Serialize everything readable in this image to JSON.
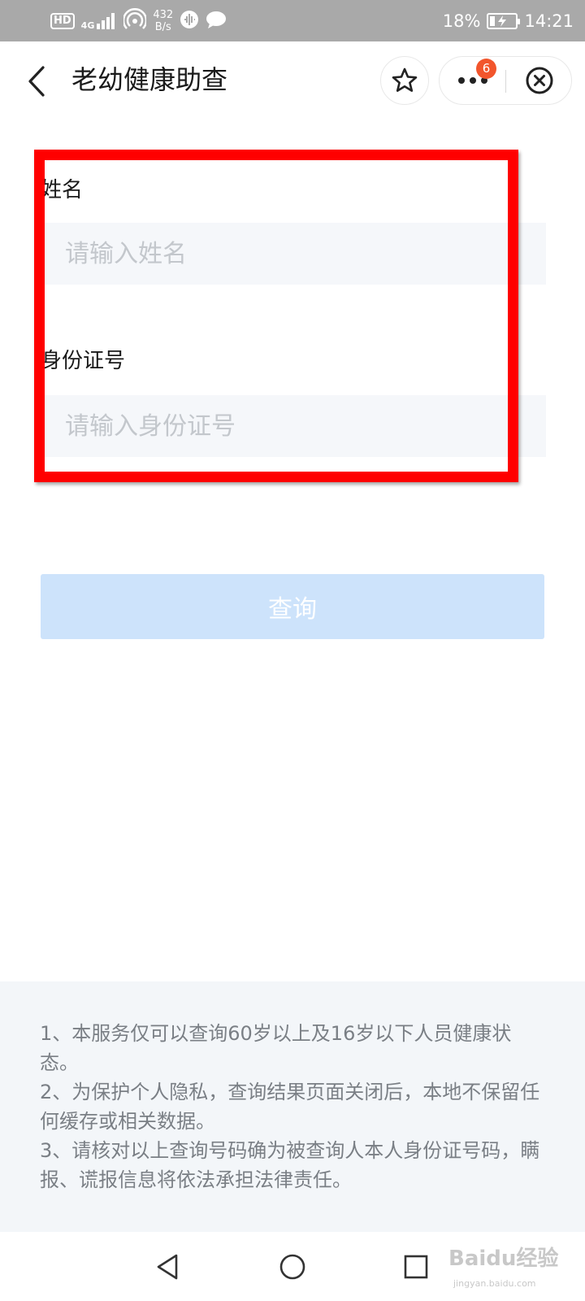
{
  "status_bar": {
    "hd": "HD",
    "network": "4G",
    "speed_value": "432",
    "speed_unit": "B/s",
    "battery_percent": "18%",
    "battery_level": 0.18,
    "time": "14:21"
  },
  "header": {
    "title": "老幼健康助查",
    "more_badge": "6"
  },
  "form": {
    "name_label": "姓名",
    "name_placeholder": "请输入姓名",
    "id_label": "身份证号",
    "id_placeholder": "请输入身份证号"
  },
  "query_button": {
    "label": "查询",
    "color": "#cde3fb"
  },
  "notice": {
    "lines": [
      "1、本服务仅可以查询60岁以上及16岁以下人员健康状态。",
      "2、为保护个人隐私，查询结果页面关闭后，本地不保留任何缓存或相关数据。",
      "3、请核对以上查询号码确为被查询人本人身份证号码，瞒报、谎报信息将依法承担法律责任。"
    ]
  },
  "watermark": {
    "logo": "Baidu经验",
    "url": "jingyan.baidu.com"
  },
  "colors": {
    "highlight": "#ff0000",
    "badge": "#f2552c",
    "input_bg": "#f5f7fa"
  }
}
